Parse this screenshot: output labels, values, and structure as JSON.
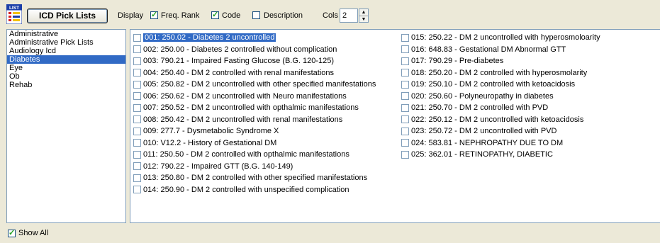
{
  "toolbar": {
    "list_icon": "list-icon",
    "list_icon_text": "LIST",
    "pick_lists_label": "ICD Pick Lists",
    "display_label": "Display",
    "freq_rank": {
      "label": "Freq. Rank",
      "checked": true
    },
    "code": {
      "label": "Code",
      "checked": true
    },
    "description": {
      "label": "Description",
      "checked": false
    },
    "cols_label": "Cols",
    "cols_value": "2"
  },
  "categories": {
    "items": [
      "Administrative",
      "Administrative Pick Lists",
      "Audiology Icd",
      "Diabetes",
      "Eye",
      "Ob",
      "Rehab"
    ],
    "selected": "Diabetes"
  },
  "codes": {
    "column1": [
      "001: 250.02 - Diabetes  2 uncontrolled",
      "002: 250.00 - Diabetes 2 controlled without complication",
      "003: 790.21 - Impaired Fasting Glucose (B.G. 120-125)",
      "004: 250.40 - DM 2 controlled with renal manifestations",
      "005: 250.82 - DM 2 uncontrolled with other specified manifestations",
      "006: 250.62 - DM 2 uncontrolled with Neuro manifestations",
      "007: 250.52 - DM 2 uncontrolled with opthalmic manifestations",
      "008: 250.42 - DM 2 uncontrolled with renal manifestations",
      "009: 277.7 - Dysmetabolic Syndrome X",
      "010: V12.2 - History of Gestational DM",
      "011: 250.50 - DM 2 controlled with opthalmic manifestations",
      "012: 790.22 - Impaired GTT (B.G. 140-149)",
      "013: 250.80 - DM 2 controlled with other specified manifestations",
      "014: 250.90 - DM 2 controlled with unspecified complication"
    ],
    "column2": [
      "015: 250.22 - DM 2 uncontrolled with hyperosmoloarity",
      "016: 648.83 - Gestational DM  Abnormal GTT",
      "017: 790.29 - Pre-diabetes",
      "018: 250.20 - DM 2 controlled with hyperosmolarity",
      "019: 250.10 - DM 2 controlled with ketoacidosis",
      "020: 250.60 - Polyneuropathy in diabetes",
      "021: 250.70 - DM 2 controlled with PVD",
      "022: 250.12 - DM 2 uncontrolled with ketoacidosis",
      "023: 250.72 - DM 2 uncontrolled with PVD",
      "024: 583.81 - NEPHROPATHY DUE TO DM",
      "025: 362.01 - RETINOPATHY, DIABETIC"
    ],
    "highlighted": "001: 250.02 - Diabetes  2 uncontrolled"
  },
  "footer": {
    "show_all": {
      "label": "Show All",
      "checked": true
    }
  },
  "colors": {
    "selection": "#316ac5",
    "window_bg": "#ece9d8",
    "border": "#7f9db9"
  }
}
